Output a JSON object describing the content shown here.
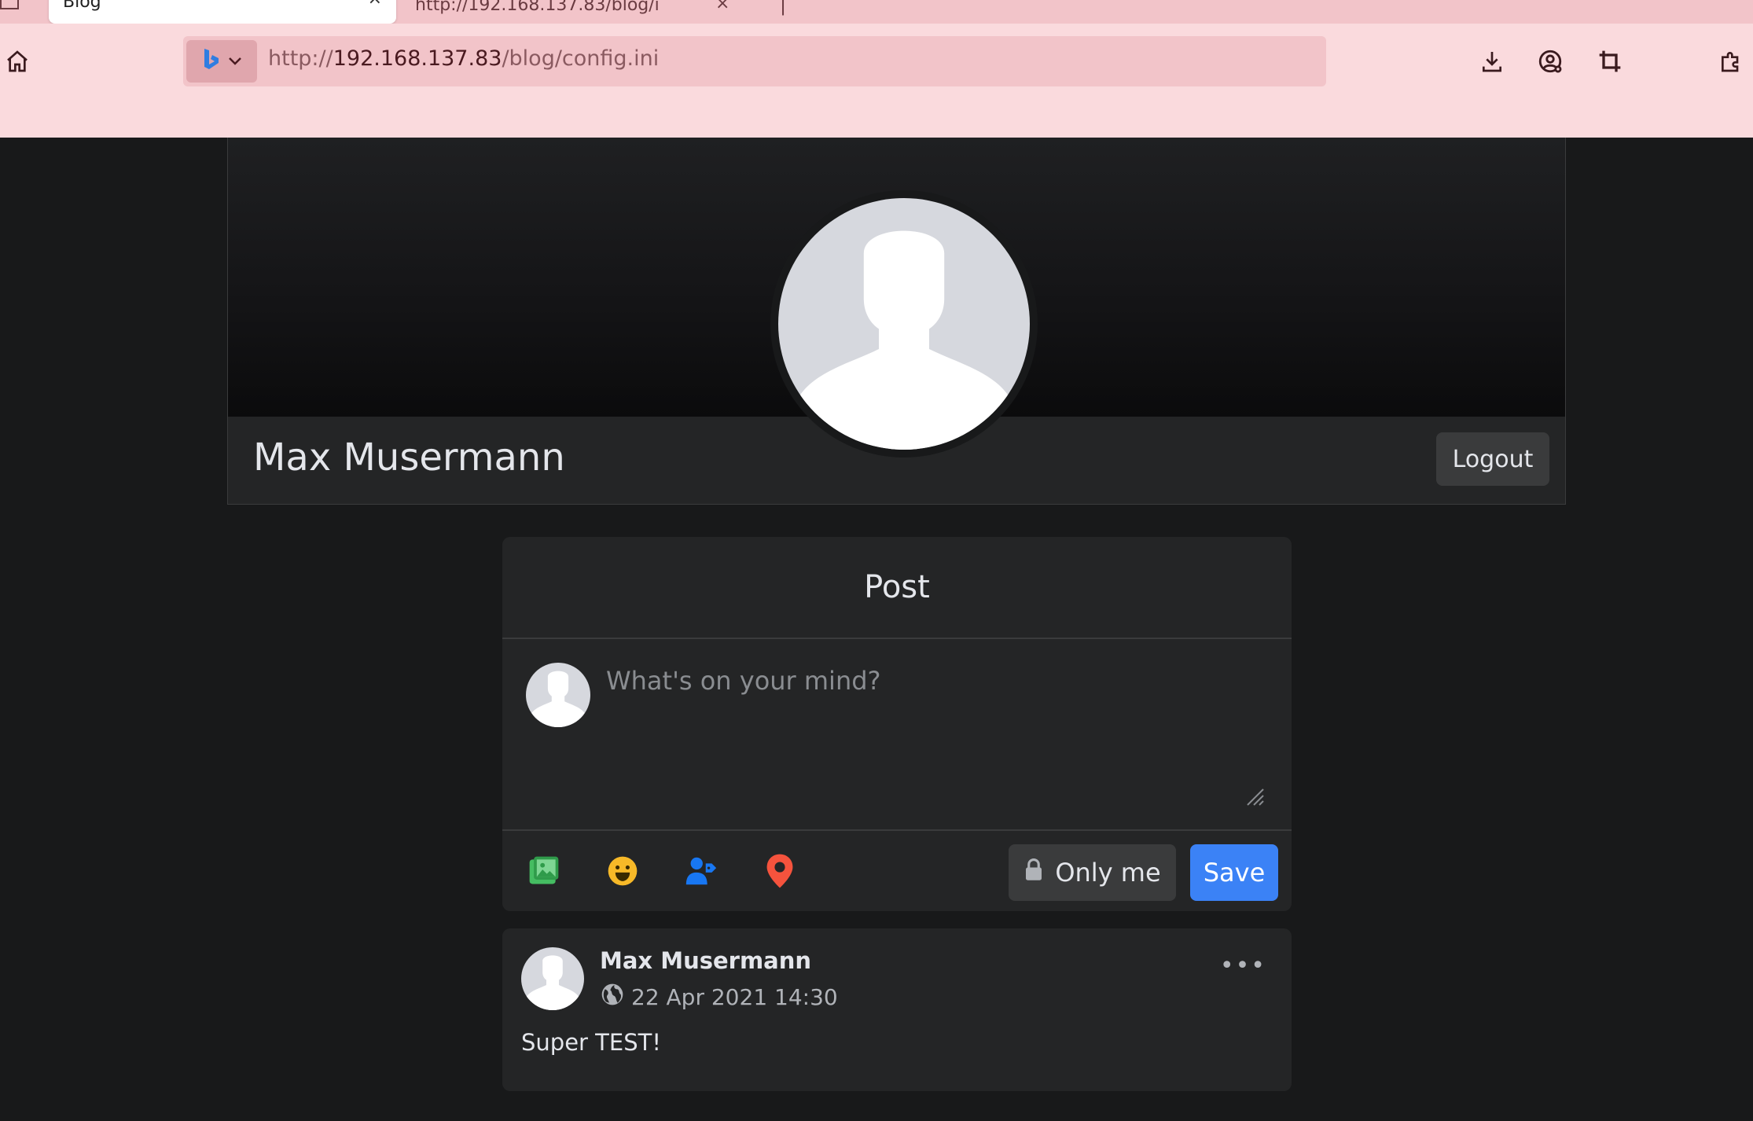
{
  "browser": {
    "active_tab_title": "Blog",
    "other_tab_title": "http://192.168.137.83/blog/i",
    "url_prefix": "http://",
    "url_host": "192.168.137.83",
    "url_path": "/blog/config.ini"
  },
  "profile": {
    "name": "Max Musermann",
    "logout_label": "Logout"
  },
  "composer": {
    "title": "Post",
    "placeholder": "What's on your mind?",
    "privacy_label": "Only me",
    "save_label": "Save"
  },
  "post": {
    "author": "Max Musermann",
    "timestamp": "22 Apr 2021 14:30",
    "body": "Super TEST!",
    "menu_glyph": "•••"
  },
  "colors": {
    "accent": "#3b82f6",
    "photo_icon": "#45bd62",
    "emoji_icon": "#f7b928",
    "tag_icon": "#1877f2",
    "location_icon": "#f5533d"
  }
}
